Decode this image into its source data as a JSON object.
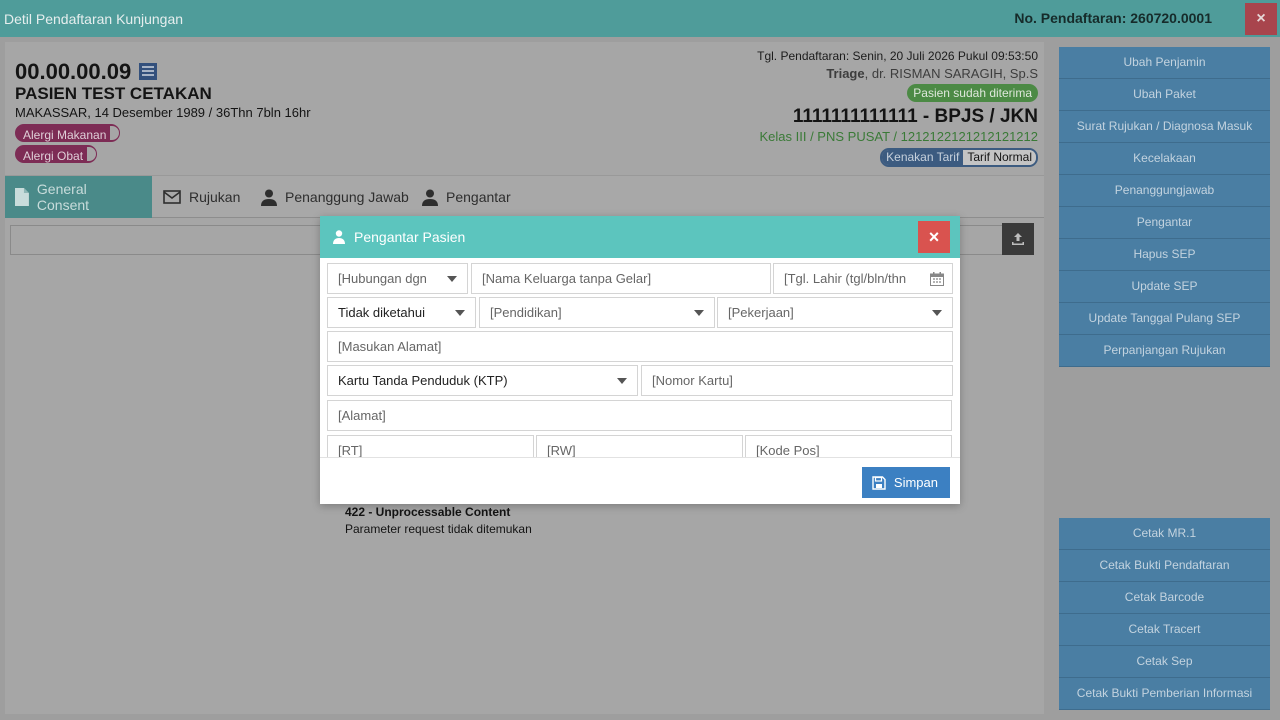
{
  "window": {
    "title": "Detil Pendaftaran Kunjungan",
    "registration_no": "No. Pendaftaran: 260720.0001",
    "close_label": "×"
  },
  "patient": {
    "id": "00.00.00.09",
    "name": "PASIEN TEST CETAKAN",
    "born": "MAKASSAR, 14 Desember 1989 / 36Thn 7bln 16hr",
    "allergies": [
      "Alergi Makanan",
      "Alergi Obat"
    ]
  },
  "registration": {
    "date": "Tgl. Pendaftaran: Senin, 20 Juli 2026 Pukul 09:53:50",
    "triage_label": "Triage",
    "doctor": ", dr. RISMAN SARAGIH, Sp.S",
    "status_badge": "Pasien sudah diterima",
    "insurance": "1111111111111 - BPJS / JKN",
    "class_info": "Kelas III / PNS PUSAT / 1212122121212121212",
    "tariff_label": "Kenakan Tarif",
    "tariff_value": "Tarif Normal"
  },
  "tabs": [
    {
      "label": "General Consent",
      "icon": "file-icon",
      "active": true
    },
    {
      "label": "Rujukan",
      "icon": "envelope-icon",
      "active": false
    },
    {
      "label": "Penanggung Jawab",
      "icon": "user-icon",
      "active": false
    },
    {
      "label": "Pengantar",
      "icon": "user-icon",
      "active": false
    }
  ],
  "error": {
    "title": "422 - Unprocessable Content",
    "message": "Parameter request tidak ditemukan"
  },
  "sidebar": {
    "top_buttons": [
      "Ubah Penjamin",
      "Ubah Paket",
      "Surat Rujukan / Diagnosa Masuk",
      "Kecelakaan",
      "Penanggungjawab",
      "Pengantar",
      "Hapus SEP",
      "Update SEP",
      "Update Tanggal Pulang SEP",
      "Perpanjangan Rujukan"
    ],
    "bottom_buttons": [
      "Cetak MR.1",
      "Cetak Bukti Pendaftaran",
      "Cetak Barcode",
      "Cetak Tracert",
      "Cetak Sep",
      "Cetak Bukti Pemberian Informasi"
    ]
  },
  "modal": {
    "title": "Pengantar Pasien",
    "close_label": "×",
    "fields": {
      "relationship": "[Hubungan dgn",
      "family_name": "[Nama Keluarga tanpa Gelar]",
      "birth_date": "[Tgl. Lahir (tgl/bln/thn",
      "gender": "Tidak diketahui",
      "education": "[Pendidikan]",
      "occupation": "[Pekerjaan]",
      "address_input": "[Masukan Alamat]",
      "id_card_type": "Kartu Tanda Penduduk (KTP)",
      "card_number": "[Nomor Kartu]",
      "address": "[Alamat]",
      "rt": "[RT]",
      "rw": "[RW]",
      "postal_code": "[Kode Pos]"
    },
    "save_label": "Simpan"
  }
}
